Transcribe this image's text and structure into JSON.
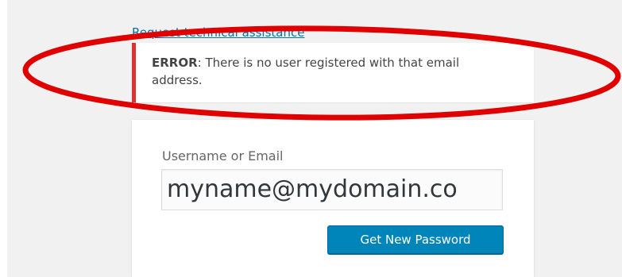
{
  "links": {
    "technical_assistance": "Request technical assistance"
  },
  "error": {
    "prefix": "ERROR",
    "message": ": There is no user registered with that email address."
  },
  "form": {
    "username_label": "Username or Email",
    "username_value": "myname@mydomain.co",
    "submit_label": "Get New Password"
  },
  "colors": {
    "page_background": "#f1f1f1",
    "error_border": "#dc3232",
    "link": "#0073aa",
    "button": "#0085ba",
    "annotation": "#e00000"
  },
  "annotation": {
    "shape": "red-ellipse-around-error"
  }
}
